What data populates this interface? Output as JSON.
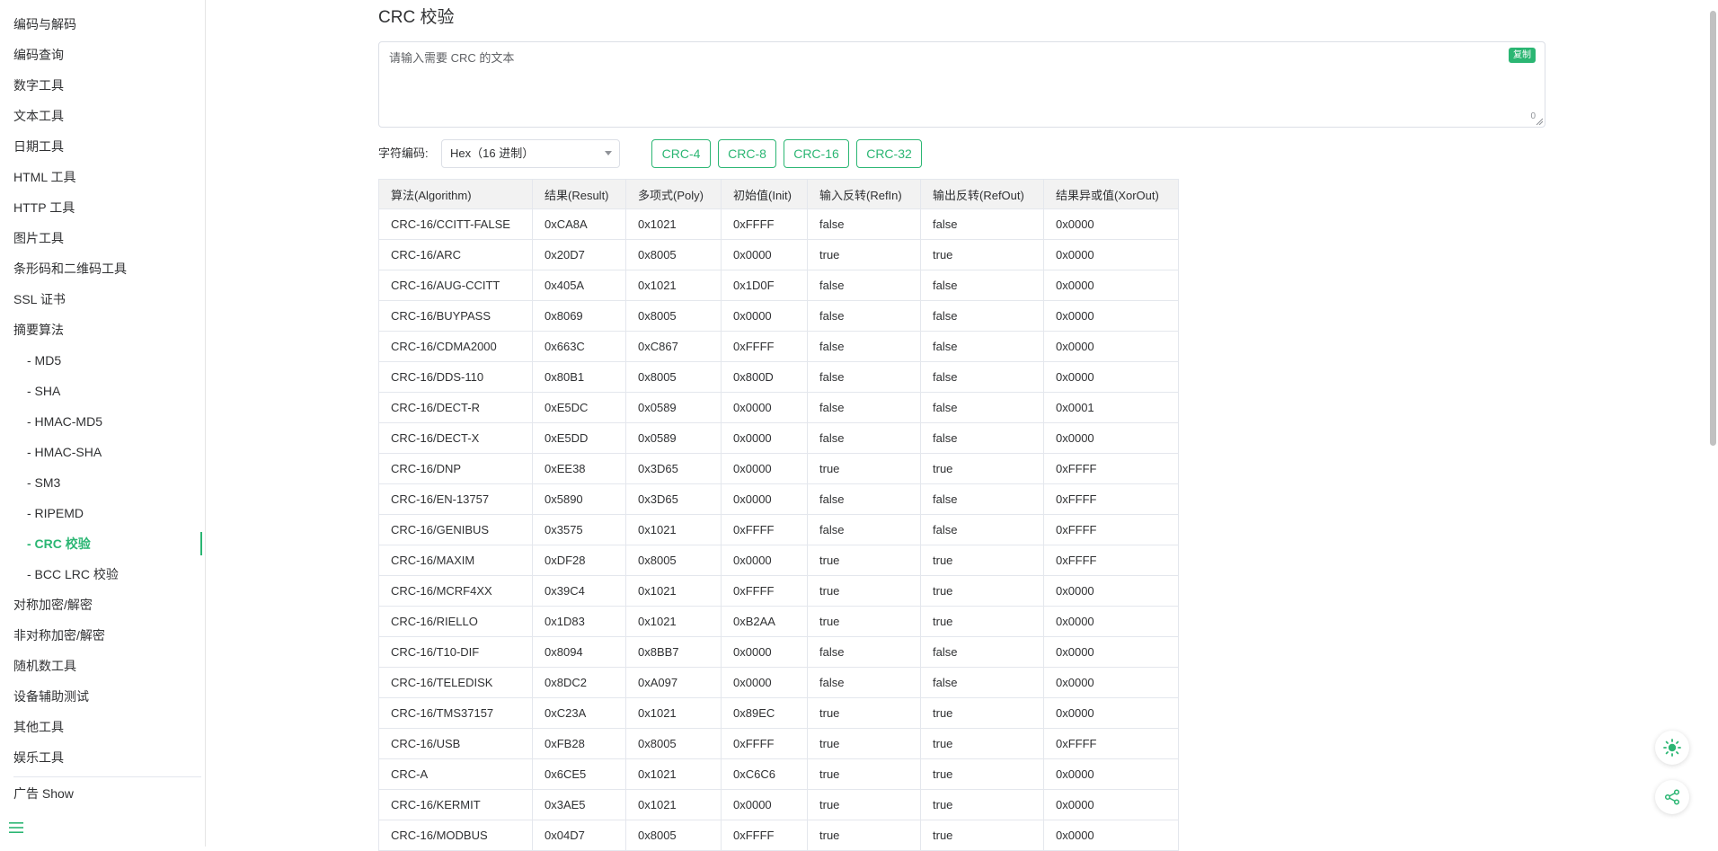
{
  "sidebar": {
    "items": [
      {
        "label": "编码与解码"
      },
      {
        "label": "编码查询"
      },
      {
        "label": "数字工具"
      },
      {
        "label": "文本工具"
      },
      {
        "label": "日期工具"
      },
      {
        "label": "HTML 工具"
      },
      {
        "label": "HTTP 工具"
      },
      {
        "label": "图片工具"
      },
      {
        "label": "条形码和二维码工具"
      },
      {
        "label": "SSL 证书"
      },
      {
        "label": "摘要算法"
      },
      {
        "label": "- MD5"
      },
      {
        "label": "- SHA"
      },
      {
        "label": "- HMAC-MD5"
      },
      {
        "label": "- HMAC-SHA"
      },
      {
        "label": "- SM3"
      },
      {
        "label": "- RIPEMD"
      },
      {
        "label": "- CRC 校验"
      },
      {
        "label": "- BCC LRC 校验"
      },
      {
        "label": "对称加密/解密"
      },
      {
        "label": "非对称加密/解密"
      },
      {
        "label": "随机数工具"
      },
      {
        "label": "设备辅助测试"
      },
      {
        "label": "其他工具"
      },
      {
        "label": "娱乐工具"
      }
    ],
    "ad_label": "广告 Show"
  },
  "main": {
    "title": "CRC 校验",
    "input": {
      "placeholder": "请输入需要 CRC 的文本",
      "value": "",
      "copy_label": "复制",
      "char_count": "0"
    },
    "encoding": {
      "label": "字符编码:",
      "selected": "Hex（16 进制）"
    },
    "crc_buttons": [
      "CRC-4",
      "CRC-8",
      "CRC-16",
      "CRC-32"
    ]
  },
  "table": {
    "headers": [
      "算法(Algorithm)",
      "结果(Result)",
      "多项式(Poly)",
      "初始值(Init)",
      "输入反转(RefIn)",
      "输出反转(RefOut)",
      "结果异或值(XorOut)"
    ],
    "rows": [
      [
        "CRC-16/CCITT-FALSE",
        "0xCA8A",
        "0x1021",
        "0xFFFF",
        "false",
        "false",
        "0x0000"
      ],
      [
        "CRC-16/ARC",
        "0x20D7",
        "0x8005",
        "0x0000",
        "true",
        "true",
        "0x0000"
      ],
      [
        "CRC-16/AUG-CCITT",
        "0x405A",
        "0x1021",
        "0x1D0F",
        "false",
        "false",
        "0x0000"
      ],
      [
        "CRC-16/BUYPASS",
        "0x8069",
        "0x8005",
        "0x0000",
        "false",
        "false",
        "0x0000"
      ],
      [
        "CRC-16/CDMA2000",
        "0x663C",
        "0xC867",
        "0xFFFF",
        "false",
        "false",
        "0x0000"
      ],
      [
        "CRC-16/DDS-110",
        "0x80B1",
        "0x8005",
        "0x800D",
        "false",
        "false",
        "0x0000"
      ],
      [
        "CRC-16/DECT-R",
        "0xE5DC",
        "0x0589",
        "0x0000",
        "false",
        "false",
        "0x0001"
      ],
      [
        "CRC-16/DECT-X",
        "0xE5DD",
        "0x0589",
        "0x0000",
        "false",
        "false",
        "0x0000"
      ],
      [
        "CRC-16/DNP",
        "0xEE38",
        "0x3D65",
        "0x0000",
        "true",
        "true",
        "0xFFFF"
      ],
      [
        "CRC-16/EN-13757",
        "0x5890",
        "0x3D65",
        "0x0000",
        "false",
        "false",
        "0xFFFF"
      ],
      [
        "CRC-16/GENIBUS",
        "0x3575",
        "0x1021",
        "0xFFFF",
        "false",
        "false",
        "0xFFFF"
      ],
      [
        "CRC-16/MAXIM",
        "0xDF28",
        "0x8005",
        "0x0000",
        "true",
        "true",
        "0xFFFF"
      ],
      [
        "CRC-16/MCRF4XX",
        "0x39C4",
        "0x1021",
        "0xFFFF",
        "true",
        "true",
        "0x0000"
      ],
      [
        "CRC-16/RIELLO",
        "0x1D83",
        "0x1021",
        "0xB2AA",
        "true",
        "true",
        "0x0000"
      ],
      [
        "CRC-16/T10-DIF",
        "0x8094",
        "0x8BB7",
        "0x0000",
        "false",
        "false",
        "0x0000"
      ],
      [
        "CRC-16/TELEDISK",
        "0x8DC2",
        "0xA097",
        "0x0000",
        "false",
        "false",
        "0x0000"
      ],
      [
        "CRC-16/TMS37157",
        "0xC23A",
        "0x1021",
        "0x89EC",
        "true",
        "true",
        "0x0000"
      ],
      [
        "CRC-16/USB",
        "0xFB28",
        "0x8005",
        "0xFFFF",
        "true",
        "true",
        "0xFFFF"
      ],
      [
        "CRC-A",
        "0x6CE5",
        "0x1021",
        "0xC6C6",
        "true",
        "true",
        "0x0000"
      ],
      [
        "CRC-16/KERMIT",
        "0x3AE5",
        "0x1021",
        "0x0000",
        "true",
        "true",
        "0x0000"
      ],
      [
        "CRC-16/MODBUS",
        "0x04D7",
        "0x8005",
        "0xFFFF",
        "true",
        "true",
        "0x0000"
      ]
    ]
  },
  "icons": {
    "menu": "hamburger-menu-icon",
    "theme": "sun-icon",
    "share": "share-icon"
  },
  "colors": {
    "accent": "#2bb673",
    "text": "#303133",
    "border": "#e4e7ed",
    "header_bg": "#f2f2f2"
  }
}
